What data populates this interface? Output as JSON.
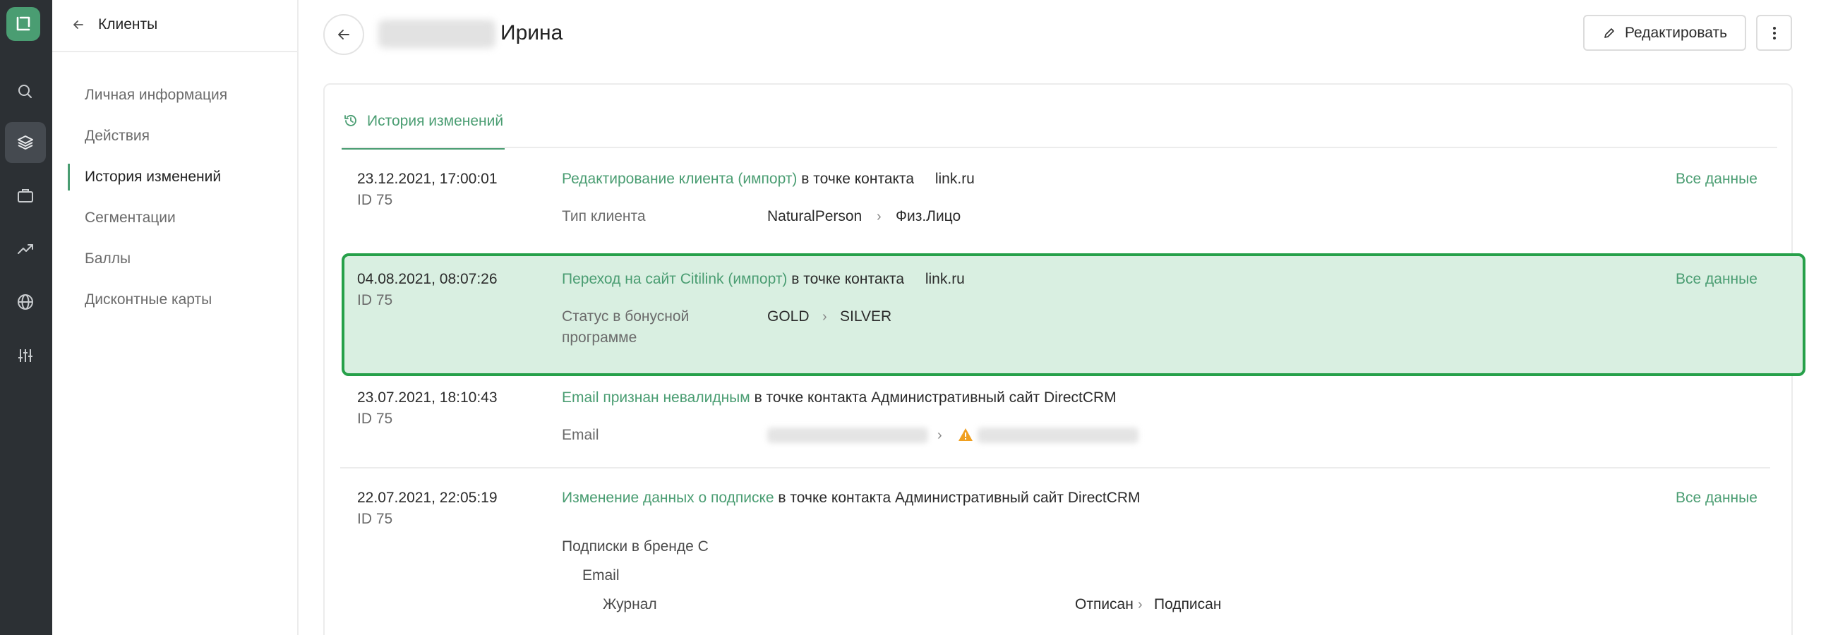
{
  "app": {
    "accent_color": "#4a9d72",
    "highlight_border_color": "#26a049",
    "highlight_fill_color": "#d9efe1"
  },
  "rail": {
    "logo_icon": "app-logo-icon",
    "items": [
      {
        "icon": "search-icon"
      },
      {
        "icon": "layers-icon",
        "active": true
      },
      {
        "icon": "briefcase-icon"
      },
      {
        "icon": "trend-up-icon"
      },
      {
        "icon": "globe-icon"
      },
      {
        "icon": "sliders-icon"
      }
    ]
  },
  "subnav": {
    "title": "Клиенты",
    "items": [
      {
        "label": "Личная информация"
      },
      {
        "label": "Действия"
      },
      {
        "label": "История изменений",
        "active": true
      },
      {
        "label": "Сегментации"
      },
      {
        "label": "Баллы"
      },
      {
        "label": "Дисконтные карты"
      }
    ]
  },
  "header": {
    "first_name": "Ирина",
    "edit_label": "Редактировать"
  },
  "tab": {
    "label": "История изменений"
  },
  "entries": [
    {
      "datetime": "23.12.2021, 17:00:01",
      "id": "ID 75",
      "action_link": "Редактирование клиента (импорт)",
      "action_text": "в точке контакта",
      "point": "link.ru",
      "all_data": "Все данные",
      "field": "Тип клиента",
      "from": "NaturalPerson",
      "to": "Физ.Лицо"
    },
    {
      "datetime": "04.08.2021, 08:07:26",
      "id": "ID 75",
      "action_link": "Переход на сайт Citilink (импорт)",
      "action_text": "в точке контакта",
      "point": "link.ru",
      "all_data": "Все данные",
      "field": "Статус в бонусной программе",
      "from": "GOLD",
      "to": "SILVER"
    },
    {
      "datetime": "23.07.2021, 18:10:43",
      "id": "ID 75",
      "action_link": "Email признан невалидным",
      "action_text": "в точке контакта Административный сайт DirectCRM",
      "field": "Email"
    },
    {
      "datetime": "22.07.2021, 22:05:19",
      "id": "ID 75",
      "action_link": "Изменение данных о подписке",
      "action_text": "в точке контакта Административный сайт DirectCRM",
      "all_data": "Все данные",
      "group": "Подписки в бренде C",
      "channel": "Email",
      "topic": "Журнал",
      "from": "Отписан",
      "to": "Подписан"
    }
  ]
}
